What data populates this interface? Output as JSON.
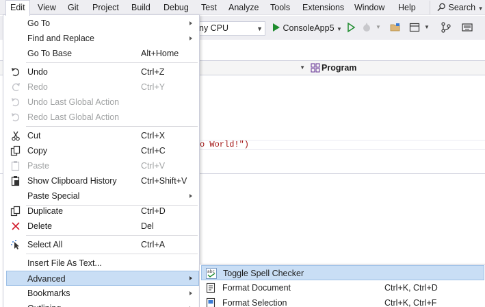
{
  "menubar": {
    "items": [
      "Edit",
      "View",
      "Git",
      "Project",
      "Build",
      "Debug",
      "Test",
      "Analyze",
      "Tools",
      "Extensions",
      "Window",
      "Help"
    ],
    "search_label": "Search"
  },
  "toolbar": {
    "platform": "ny CPU",
    "run_target": "ConsoleApp5"
  },
  "editor": {
    "nav_right": "Program",
    "code_fragment": "o World!\")"
  },
  "edit_menu": {
    "items": [
      {
        "label": "Go To",
        "shortcut": "",
        "submenu": true,
        "icon": ""
      },
      {
        "label": "Find and Replace",
        "shortcut": "",
        "submenu": true,
        "icon": ""
      },
      {
        "label": "Go To Base",
        "shortcut": "Alt+Home",
        "icon": ""
      },
      {
        "label": "Undo",
        "shortcut": "Ctrl+Z",
        "icon": "undo-icon"
      },
      {
        "label": "Redo",
        "shortcut": "Ctrl+Y",
        "icon": "redo-icon",
        "disabled": true
      },
      {
        "label": "Undo Last Global Action",
        "shortcut": "",
        "icon": "undo-global-icon",
        "disabled": true
      },
      {
        "label": "Redo Last Global Action",
        "shortcut": "",
        "icon": "redo-global-icon",
        "disabled": true
      },
      {
        "label": "Cut",
        "shortcut": "Ctrl+X",
        "icon": "scissors-icon"
      },
      {
        "label": "Copy",
        "shortcut": "Ctrl+C",
        "icon": "copy-icon"
      },
      {
        "label": "Paste",
        "shortcut": "Ctrl+V",
        "icon": "paste-icon",
        "disabled": true
      },
      {
        "label": "Show Clipboard History",
        "shortcut": "Ctrl+Shift+V",
        "icon": "clipboard-history-icon"
      },
      {
        "label": "Paste Special",
        "shortcut": "",
        "submenu": true,
        "icon": ""
      },
      {
        "label": "Duplicate",
        "shortcut": "Ctrl+D",
        "icon": "duplicate-icon"
      },
      {
        "label": "Delete",
        "shortcut": "Del",
        "icon": "delete-icon"
      },
      {
        "label": "Select All",
        "shortcut": "Ctrl+A",
        "icon": "select-all-icon"
      },
      {
        "label": "Insert File As Text...",
        "shortcut": "",
        "icon": ""
      },
      {
        "label": "Advanced",
        "shortcut": "",
        "submenu": true,
        "icon": "",
        "highlighted": true
      },
      {
        "label": "Bookmarks",
        "shortcut": "",
        "submenu": true,
        "icon": ""
      },
      {
        "label": "Outlining",
        "shortcut": "",
        "submenu": true,
        "icon": ""
      }
    ]
  },
  "advanced_submenu": {
    "items": [
      {
        "label": "Toggle Spell Checker",
        "shortcut": "",
        "icon": "spell-check-icon",
        "highlighted": true
      },
      {
        "label": "Format Document",
        "shortcut": "Ctrl+K, Ctrl+D",
        "icon": "format-document-icon"
      },
      {
        "label": "Format Selection",
        "shortcut": "Ctrl+K, Ctrl+F",
        "icon": "format-selection-icon"
      }
    ]
  },
  "colors": {
    "chrome": "#eeeef2",
    "highlight": "#c9def5",
    "highlight_border": "#9ec0e6",
    "string_literal": "#a31515",
    "run_green": "#1e8c2e"
  }
}
